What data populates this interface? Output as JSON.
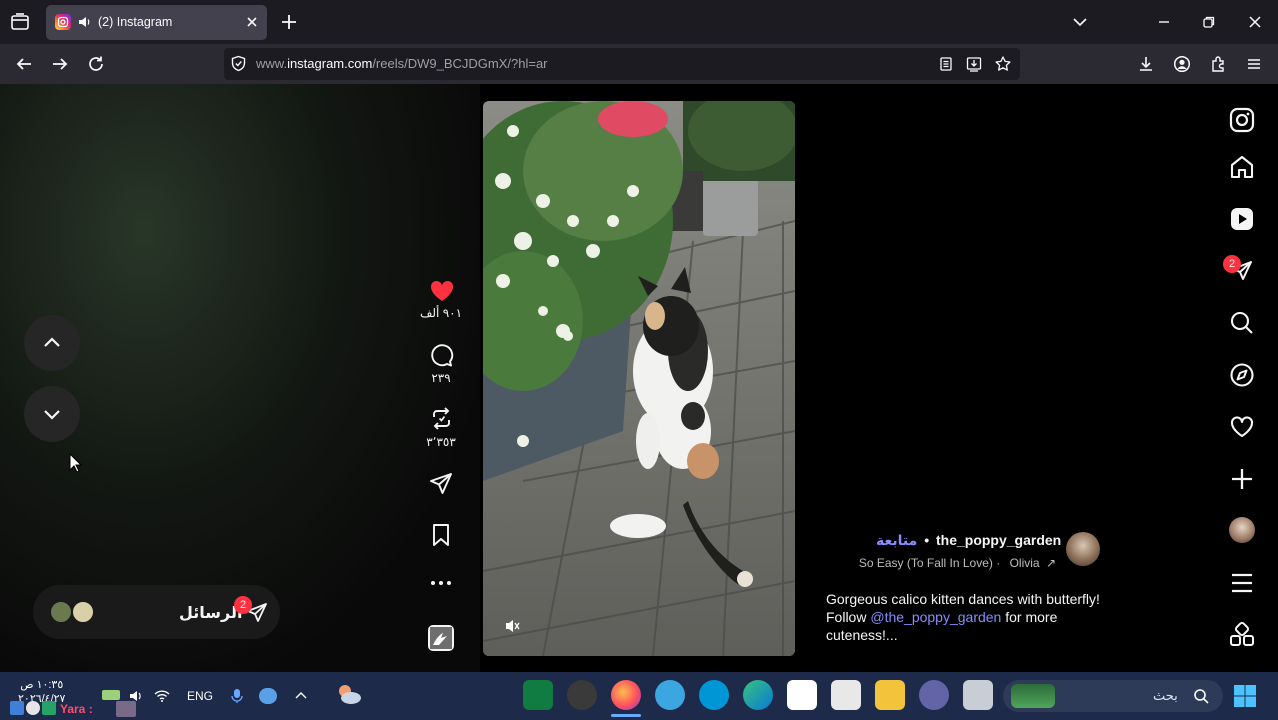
{
  "browser": {
    "tab_title": "(2) Instagram",
    "url_prefix": "www.",
    "url_domain": "instagram.com",
    "url_path": "/reels/DW9_BCJDGmX/?hl=ar"
  },
  "actions": {
    "likes": "٩٠١ ألف",
    "comments": "٢٣٩",
    "reposts": "٣٬٣٥٣"
  },
  "reel": {
    "username": "the_poppy_garden",
    "follow_label": "متابعة",
    "separator": "•",
    "audio_artist": "Olivia",
    "audio_title": "So Easy (To Fall In Love) ·",
    "caption_text": "Gorgeous calico kitten dances with butterfly! Follow ",
    "caption_mention": "@the_poppy_garden",
    "caption_tail": " for more cuteness!...",
    "more_label": "..."
  },
  "messages": {
    "label": "الرسائل",
    "badge": "2"
  },
  "sidebar": {
    "messages_badge": "2"
  },
  "taskbar": {
    "time": "١٠:٣٥ ص",
    "date": "٢٠٢٦/٤/٢٧",
    "language": "ENG",
    "search_placeholder": "بحث",
    "notification_user": "Yara :"
  },
  "colors": {
    "accent_blue": "#858dff",
    "like_red": "#ff3040",
    "badge_red": "#ff3040"
  }
}
